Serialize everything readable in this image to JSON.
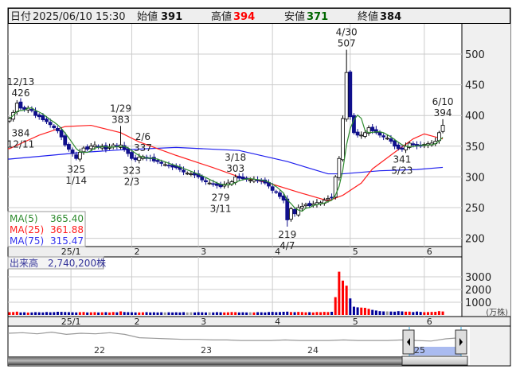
{
  "header": {
    "date_label": "日付",
    "date": "2025/06/10 15:30",
    "open_label": "始値",
    "open": "391",
    "high_label": "高値",
    "high": "394",
    "low_label": "安値",
    "low": "371",
    "close_label": "終値",
    "close": "384"
  },
  "legend": {
    "ma5_label": "MA(5)",
    "ma5": "365.40",
    "ma25_label": "MA(25)",
    "ma25": "361.88",
    "ma75_label": "MA(75)",
    "ma75": "315.47"
  },
  "volume_label": "出来高　2,740,200株",
  "colors": {
    "up_volume": "#ff0000",
    "down_volume": "#000099",
    "flat": "#999999",
    "ma5": "#2e8b2e",
    "ma25": "#ff2020",
    "ma75": "#2020ee",
    "candle_down": "#10108c"
  },
  "chart_data": {
    "type": "candlestick",
    "price_axis": {
      "ylim": [
        180,
        540
      ],
      "ticks": [
        "500",
        "450",
        "400",
        "350",
        "300",
        "250",
        "200"
      ]
    },
    "volume_axis": {
      "ticks": [
        "3000",
        "2000",
        "1000"
      ],
      "unit": "(万株)"
    },
    "x_ticks": [
      {
        "label": "25/1",
        "index": 14
      },
      {
        "label": "2",
        "index": 33
      },
      {
        "label": "3",
        "index": 51
      },
      {
        "label": "4",
        "index": 71
      },
      {
        "label": "5",
        "index": 92
      },
      {
        "label": "6",
        "index": 112
      }
    ],
    "closes": [
      395,
      405,
      420,
      412,
      410,
      412,
      408,
      400,
      398,
      393,
      390,
      385,
      380,
      375,
      365,
      352,
      345,
      338,
      330,
      340,
      347,
      345,
      350,
      352,
      348,
      350,
      345,
      348,
      352,
      350,
      352,
      345,
      338,
      330,
      328,
      332,
      333,
      330,
      330,
      326,
      325,
      322,
      320,
      318,
      316,
      315,
      312,
      308,
      306,
      305,
      303,
      300,
      295,
      292,
      290,
      288,
      286,
      284,
      288,
      290,
      292,
      300,
      298,
      297,
      296,
      295,
      296,
      294,
      293,
      290,
      285,
      278,
      275,
      268,
      262,
      230,
      248,
      240,
      250,
      252,
      255,
      253,
      256,
      258,
      258,
      262,
      265,
      266,
      300,
      330,
      395,
      470,
      398,
      372,
      368,
      368,
      372,
      380,
      375,
      372,
      368,
      365,
      363,
      358,
      350,
      346,
      345,
      350,
      355,
      352,
      350,
      350,
      353,
      354,
      355,
      358,
      372,
      384
    ],
    "volume": [
      220,
      230,
      260,
      200,
      210,
      190,
      200,
      220,
      210,
      200,
      230,
      210,
      220,
      250,
      240,
      230,
      220,
      210,
      200,
      220,
      230,
      200,
      210,
      220,
      200,
      210,
      220,
      200,
      230,
      210,
      280,
      230,
      220,
      210,
      200,
      200,
      210,
      220,
      200,
      210,
      200,
      210,
      200,
      210,
      200,
      210,
      200,
      220,
      200,
      210,
      200,
      220,
      210,
      200,
      210,
      200,
      220,
      210,
      200,
      210,
      230,
      220,
      200,
      210,
      200,
      210,
      200,
      220,
      210,
      200,
      230,
      240,
      220,
      230,
      250,
      260,
      230,
      220,
      240,
      230,
      210,
      220,
      200,
      230,
      220,
      240,
      230,
      250,
      1400,
      3400,
      2700,
      2300,
      1300,
      650,
      600,
      580,
      560,
      480,
      400,
      350,
      300,
      280,
      280,
      270,
      260,
      300,
      280,
      260,
      260,
      230,
      270,
      240,
      220,
      230,
      240,
      250,
      300,
      274
    ],
    "ma25": [
      [
        0,
        346
      ],
      [
        8,
        368
      ],
      [
        15,
        382
      ],
      [
        22,
        384
      ],
      [
        30,
        372
      ],
      [
        35,
        357
      ],
      [
        45,
        335
      ],
      [
        55,
        315
      ],
      [
        62,
        300
      ],
      [
        70,
        290
      ],
      [
        78,
        275
      ],
      [
        86,
        261
      ],
      [
        90,
        270
      ],
      [
        95,
        290
      ],
      [
        98,
        313
      ],
      [
        104,
        340
      ],
      [
        109,
        362
      ],
      [
        112,
        370
      ],
      [
        115,
        365
      ],
      [
        117,
        361.88
      ]
    ],
    "ma75": [
      [
        0,
        329
      ],
      [
        20,
        340
      ],
      [
        30,
        344
      ],
      [
        45,
        348
      ],
      [
        62,
        343
      ],
      [
        75,
        325
      ],
      [
        86,
        305
      ],
      [
        90,
        305
      ],
      [
        100,
        310
      ],
      [
        110,
        312
      ],
      [
        117,
        315.47
      ]
    ],
    "annotations": [
      {
        "date": "12/11",
        "value": "384",
        "index": 0,
        "price": 384,
        "pos": "below"
      },
      {
        "date": "12/13",
        "value": "426",
        "index": 2,
        "price": 426,
        "pos": "above"
      },
      {
        "date": "1/14",
        "value": "325",
        "index": 18,
        "price": 325,
        "pos": "below"
      },
      {
        "date": "1/29",
        "value": "383",
        "index": 30,
        "price": 383,
        "pos": "above"
      },
      {
        "date": "2/3",
        "value": "323",
        "index": 33,
        "price": 323,
        "pos": "below"
      },
      {
        "date": "2/6",
        "value": "337",
        "index": 36,
        "price": 337,
        "pos": "above"
      },
      {
        "date": "3/11",
        "value": "279",
        "index": 57,
        "price": 279,
        "pos": "below"
      },
      {
        "date": "3/18",
        "value": "303",
        "index": 61,
        "price": 303,
        "pos": "above"
      },
      {
        "date": "4/7",
        "value": "219",
        "index": 75,
        "price": 219,
        "pos": "below"
      },
      {
        "date": "4/30",
        "value": "507",
        "index": 91,
        "price": 507,
        "pos": "above"
      },
      {
        "date": "5/23",
        "value": "341",
        "index": 106,
        "price": 341,
        "pos": "below"
      },
      {
        "date": "6/10",
        "value": "394",
        "index": 117,
        "price": 394,
        "pos": "above"
      }
    ]
  },
  "navigator": {
    "year_labels": [
      "22",
      "23",
      "24",
      "25"
    ],
    "series": [
      30,
      31,
      29,
      32,
      28,
      30,
      29,
      31,
      28,
      22,
      21,
      20,
      19,
      19,
      18,
      18,
      17,
      17,
      17,
      18,
      17,
      17,
      17,
      18,
      17,
      17,
      17,
      18,
      17,
      16,
      20,
      22
    ]
  }
}
